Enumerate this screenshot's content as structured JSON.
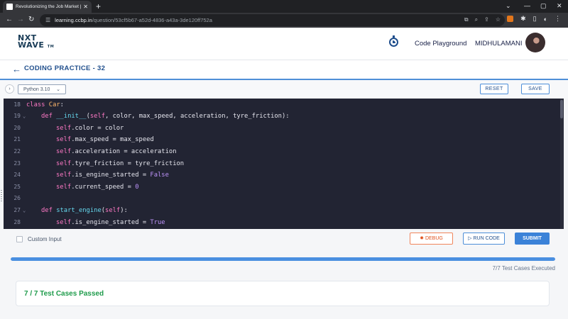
{
  "browser": {
    "tab_title": "Revolutionizing the Job Market |",
    "url_host": "learning.ccbp.in",
    "url_path": "/question/53cf5b67-a52d-4836-a43a-3de120ff752a"
  },
  "header": {
    "logo_line1": "NXT",
    "logo_line2": "WAVE",
    "logo_tm": "TM",
    "code_playground": "Code Playground",
    "username": "MIDHULAMANI"
  },
  "practice": {
    "title": "CODING PRACTICE - 32"
  },
  "toolbar": {
    "language": "Python 3.10",
    "reset_label": "RESET",
    "save_label": "SAVE"
  },
  "editor": {
    "lines": [
      {
        "n": "18",
        "indent": 0,
        "fold": false,
        "tokens": [
          [
            "kw",
            "class "
          ],
          [
            "cls",
            "Car"
          ],
          [
            "op",
            ":"
          ]
        ]
      },
      {
        "n": "19",
        "indent": 1,
        "fold": true,
        "tokens": [
          [
            "kw",
            "def "
          ],
          [
            "fn",
            "__init__"
          ],
          [
            "op",
            "("
          ],
          [
            "slf",
            "self"
          ],
          [
            "op",
            ", color, max_speed, acceleration, tyre_friction):"
          ]
        ]
      },
      {
        "n": "20",
        "indent": 2,
        "fold": false,
        "tokens": [
          [
            "slf",
            "self"
          ],
          [
            "attr",
            ".color"
          ],
          [
            "op",
            " = color"
          ]
        ]
      },
      {
        "n": "21",
        "indent": 2,
        "fold": false,
        "tokens": [
          [
            "slf",
            "self"
          ],
          [
            "attr",
            ".max_speed"
          ],
          [
            "op",
            " = max_speed"
          ]
        ]
      },
      {
        "n": "22",
        "indent": 2,
        "fold": false,
        "tokens": [
          [
            "slf",
            "self"
          ],
          [
            "attr",
            ".acceleration"
          ],
          [
            "op",
            " = acceleration"
          ]
        ]
      },
      {
        "n": "23",
        "indent": 2,
        "fold": false,
        "tokens": [
          [
            "slf",
            "self"
          ],
          [
            "attr",
            ".tyre_friction"
          ],
          [
            "op",
            " = tyre_friction"
          ]
        ]
      },
      {
        "n": "24",
        "indent": 2,
        "fold": false,
        "tokens": [
          [
            "slf",
            "self"
          ],
          [
            "attr",
            ".is_engine_started"
          ],
          [
            "op",
            " = "
          ],
          [
            "val",
            "False"
          ]
        ]
      },
      {
        "n": "25",
        "indent": 2,
        "fold": false,
        "tokens": [
          [
            "slf",
            "self"
          ],
          [
            "attr",
            ".current_speed"
          ],
          [
            "op",
            " = "
          ],
          [
            "val",
            "0"
          ]
        ]
      },
      {
        "n": "26",
        "indent": 0,
        "fold": false,
        "tokens": []
      },
      {
        "n": "27",
        "indent": 1,
        "fold": true,
        "tokens": [
          [
            "kw",
            "def "
          ],
          [
            "fn",
            "start_engine"
          ],
          [
            "op",
            "("
          ],
          [
            "slf",
            "self"
          ],
          [
            "op",
            "):"
          ]
        ]
      },
      {
        "n": "28",
        "indent": 2,
        "fold": false,
        "tokens": [
          [
            "slf",
            "self"
          ],
          [
            "attr",
            ".is_engine_started"
          ],
          [
            "op",
            " = "
          ],
          [
            "val",
            "True"
          ]
        ]
      }
    ]
  },
  "controls": {
    "custom_input_label": "Custom Input",
    "debug_label": "DEBUG",
    "run_label": "RUN CODE",
    "submit_label": "SUBMIT"
  },
  "results": {
    "progress_fraction": 1.0,
    "executed_text": "7/7 Test Cases Executed",
    "passed_text": "7 / 7 Test Cases Passed"
  },
  "colors": {
    "accent": "#3b82d8",
    "success": "#1e9b4b",
    "debug": "#e0531f",
    "editor_bg": "#222433"
  }
}
